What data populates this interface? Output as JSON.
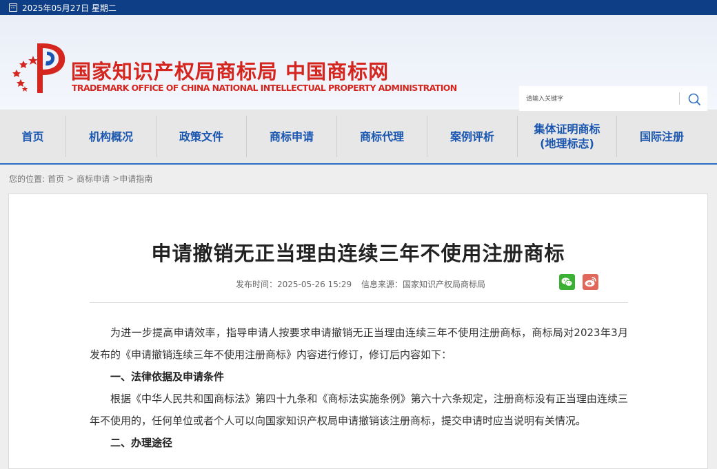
{
  "topbar": {
    "date": "2025年05月27日 星期二"
  },
  "header": {
    "cn_name": "国家知识产权局商标局 中国商标网",
    "en_name": "TRADEMARK OFFICE OF CHINA NATIONAL INTELLECTUAL PROPERTY ADMINISTRATION",
    "search_placeholder": "请输入关键字"
  },
  "nav": {
    "items": [
      {
        "label": "首页"
      },
      {
        "label": "机构概况"
      },
      {
        "label": "政策文件"
      },
      {
        "label": "商标申请"
      },
      {
        "label": "商标代理"
      },
      {
        "label": "案例评析"
      },
      {
        "label": "集体证明商标\n(地理标志)"
      },
      {
        "label": "国际注册"
      }
    ]
  },
  "breadcrumb": {
    "prefix": "您的位置:",
    "items": [
      "首页",
      "商标申请",
      "申请指南"
    ],
    "separator": ">"
  },
  "article": {
    "title": "申请撤销无正当理由连续三年不使用注册商标",
    "publish_time": "发布时间：2025-05-26 15:29",
    "source": "信息来源：国家知识产权局商标局",
    "paragraphs": [
      {
        "text": "为进一步提高申请效率，指导申请人按要求申请撤销无正当理由连续三年不使用注册商标，商标局对2023年3月发布的《申请撤销连续三年不使用注册商标》内容进行修订，修订后内容如下：",
        "heading": false
      },
      {
        "text": "一、法律依据及申请条件",
        "heading": true
      },
      {
        "text": "根据《中华人民共和国商标法》第四十九条和《商标法实施条例》第六十六条规定，注册商标没有正当理由连续三年不使用的，任何单位或者个人可以向国家知识产权局申请撤销该注册商标，提交申请时应当说明有关情况。",
        "heading": false
      },
      {
        "text": "二、办理途径",
        "heading": true
      }
    ]
  },
  "colors": {
    "topbar": "#0d3e86",
    "brand_red": "#d4261f",
    "nav_text": "#1a56b0"
  },
  "icons": {
    "calendar": "calendar-icon",
    "search": "search-icon",
    "wechat": "wechat-icon",
    "weibo": "weibo-icon",
    "logo": "cnipa-logo"
  }
}
